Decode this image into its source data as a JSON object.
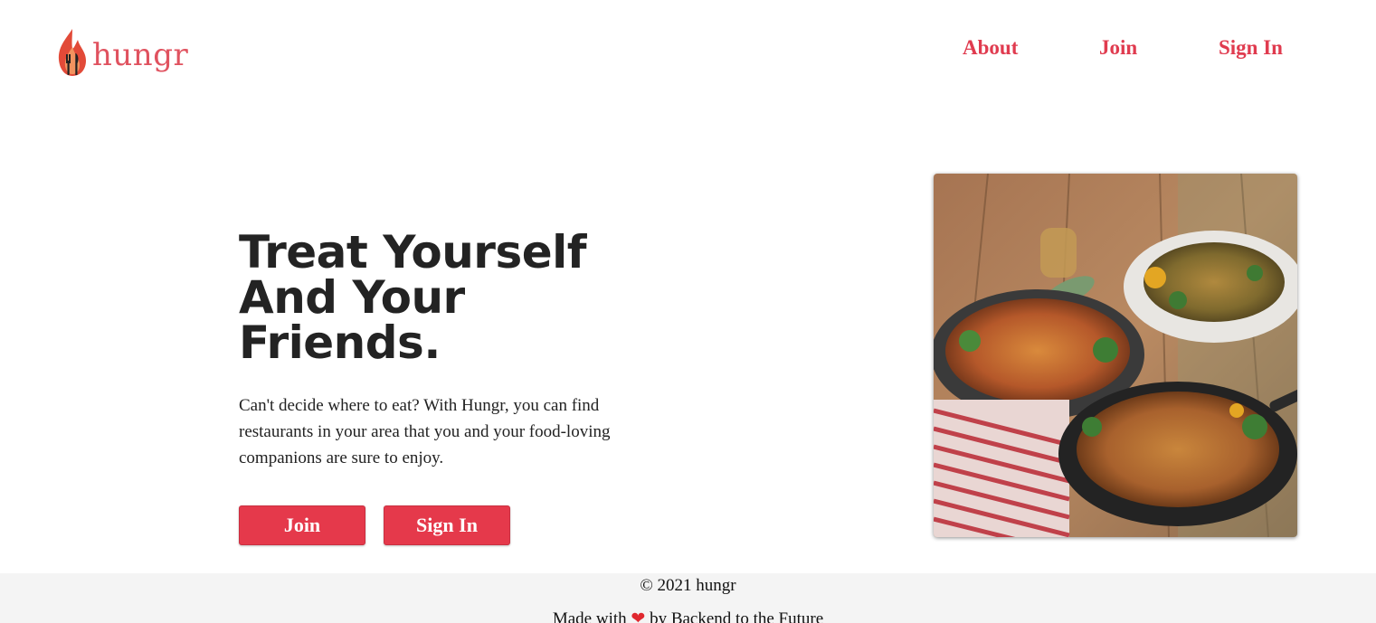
{
  "header": {
    "logo_text": "hungr",
    "nav": {
      "about": "About",
      "join": "Join",
      "sign_in": "Sign In"
    }
  },
  "hero": {
    "title_line1": "Treat Yourself",
    "title_line2": "And Your",
    "title_line3": "Friends.",
    "description": "Can't decide where to eat? With Hungr, you can find restaurants in your area that you and your food-loving companions are sure to enjoy.",
    "join_button": "Join",
    "sign_in_button": "Sign In"
  },
  "footer": {
    "copyright": "© 2021 hungr",
    "made_with_prefix": "Made with",
    "heart": "❤",
    "made_with_suffix": "by Backend to the Future"
  },
  "colors": {
    "brand_red": "#e5394b",
    "nav_red": "#e03b4f",
    "footer_bg": "#f4f4f4"
  },
  "icons": {
    "logo": "flame-fork-knife-icon",
    "heart": "heart-icon"
  }
}
